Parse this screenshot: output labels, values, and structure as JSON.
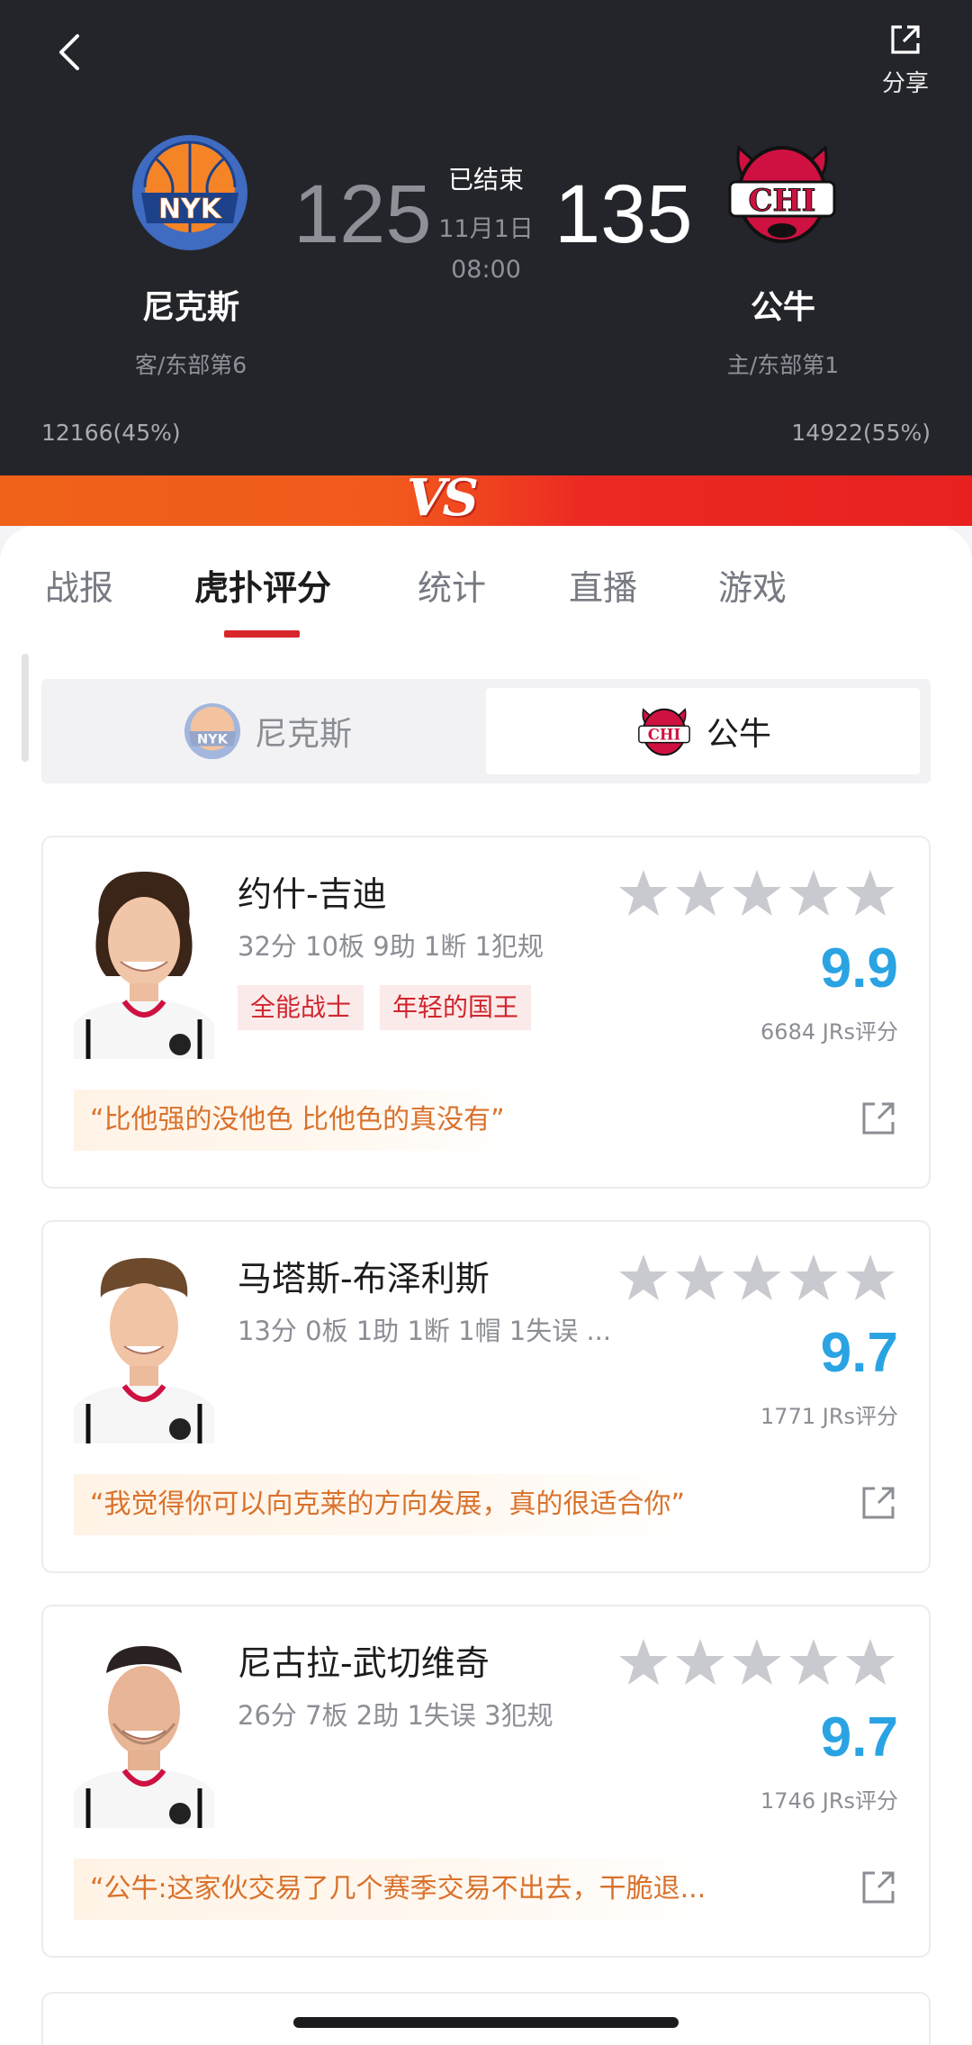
{
  "header": {
    "share_label": "分享",
    "status": "已结束",
    "date": "11月1日",
    "time": "08:00",
    "away": {
      "name": "尼克斯",
      "rank": "客/东部第6",
      "score": "125",
      "votes": "12166(45%)",
      "logo_text": "NYK",
      "color": "#f58426"
    },
    "home": {
      "name": "公牛",
      "rank": "主/东部第1",
      "score": "135",
      "votes": "14922(55%)",
      "logo_text": "CHI",
      "color": "#ce1141"
    },
    "vs_text": "VS"
  },
  "tabs": [
    {
      "label": "战报"
    },
    {
      "label": "虎扑评分"
    },
    {
      "label": "统计"
    },
    {
      "label": "直播"
    },
    {
      "label": "游戏"
    }
  ],
  "active_tab": "虎扑评分",
  "team_switch": {
    "left": "尼克斯",
    "right": "公牛",
    "selected": "公牛"
  },
  "players": [
    {
      "name": "约什-吉迪",
      "stats": "32分 10板 9助 1断 1犯规",
      "tags": [
        "全能战士",
        "年轻的国王"
      ],
      "rating": "9.9",
      "rating_count": "6684 JRs评分",
      "comment": "“比他强的没他色 比他色的真没有”",
      "star_fill": 0
    },
    {
      "name": "马塔斯-布泽利斯",
      "stats": "13分 0板 1助 1断 1帽 1失误 ...",
      "tags": [],
      "rating": "9.7",
      "rating_count": "1771 JRs评分",
      "comment": "“我觉得你可以向克莱的方向发展，真的很适合你”",
      "star_fill": 0
    },
    {
      "name": "尼古拉-武切维奇",
      "stats": "26分 7板 2助 1失误 3犯规",
      "tags": [],
      "rating": "9.7",
      "rating_count": "1746 JRs评分",
      "comment": "“公牛:这家伙交易了几个赛季交易不出去，干脆退...",
      "star_fill": 0
    }
  ],
  "colors": {
    "accent_red": "#d9262c",
    "rating_blue": "#2aa3e3",
    "comment_orange": "#d9722c",
    "header_bg": "#24252a"
  },
  "icons": [
    "back-icon",
    "share-icon",
    "star-icon",
    "open-external-icon"
  ]
}
